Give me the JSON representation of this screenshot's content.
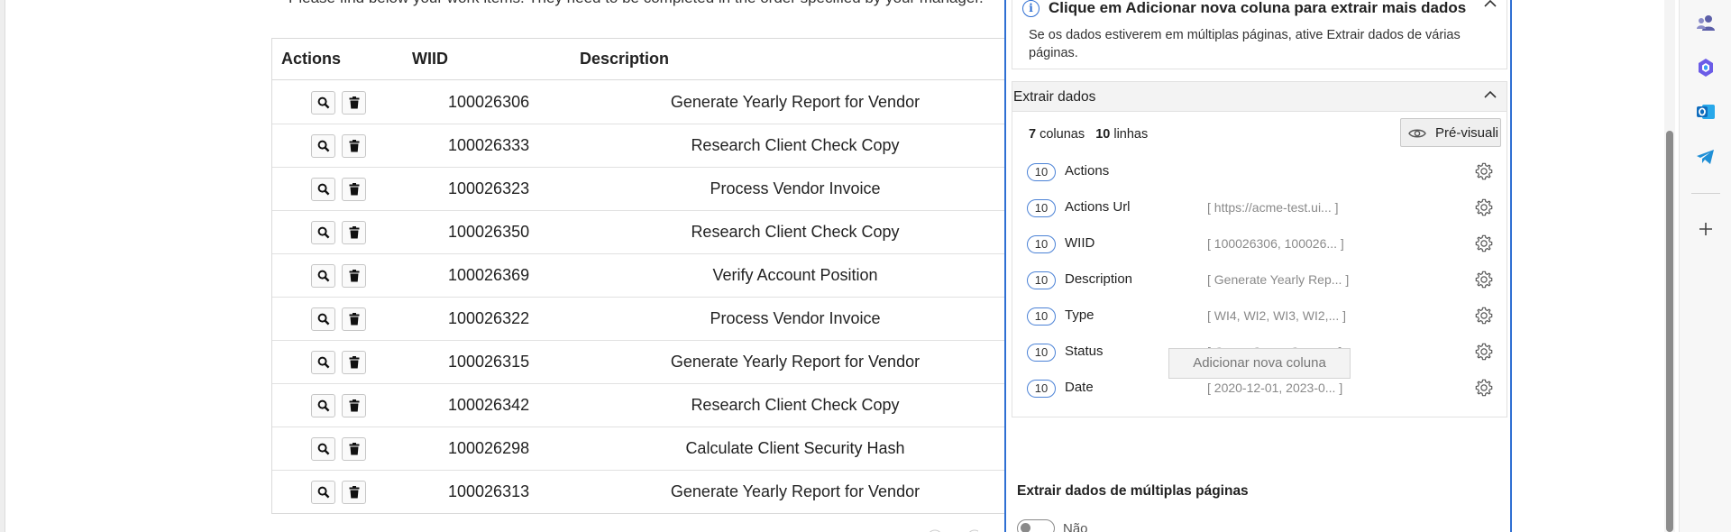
{
  "page": {
    "intro": "Please find below your work items. They need to be completed in the order specified by your manager."
  },
  "table": {
    "headers": {
      "actions": "Actions",
      "wiid": "WIID",
      "description": "Description"
    },
    "rows": [
      {
        "wiid": "100026306",
        "description": "Generate Yearly Report for Vendor"
      },
      {
        "wiid": "100026333",
        "description": "Research Client Check Copy"
      },
      {
        "wiid": "100026323",
        "description": "Process Vendor Invoice"
      },
      {
        "wiid": "100026350",
        "description": "Research Client Check Copy"
      },
      {
        "wiid": "100026369",
        "description": "Verify Account Position"
      },
      {
        "wiid": "100026322",
        "description": "Process Vendor Invoice"
      },
      {
        "wiid": "100026315",
        "description": "Generate Yearly Report for Vendor"
      },
      {
        "wiid": "100026342",
        "description": "Research Client Check Copy"
      },
      {
        "wiid": "100026298",
        "description": "Calculate Client Security Hash"
      },
      {
        "wiid": "100026313",
        "description": "Generate Yearly Report for Vendor"
      }
    ]
  },
  "panel": {
    "info": {
      "title": "Clique em Adicionar nova coluna para extrair mais dados",
      "text": "Se os dados estiverem em múltiplas páginas, ative Extrair dados de várias páginas."
    },
    "extract": {
      "title": "Extrair dados",
      "columns_count": "7",
      "columns_label": "colunas",
      "rows_count": "10",
      "rows_label": "linhas",
      "preview_label": "Pré-visuali",
      "fields": [
        {
          "count": "10",
          "name": "Actions",
          "preview": ""
        },
        {
          "count": "10",
          "name": "Actions Url",
          "preview": "[ https://acme-test.ui... ]"
        },
        {
          "count": "10",
          "name": "WIID",
          "preview": "[ 100026306, 100026... ]"
        },
        {
          "count": "10",
          "name": "Description",
          "preview": "[ Generate Yearly Rep... ]"
        },
        {
          "count": "10",
          "name": "Type",
          "preview": "[ WI4, WI2, WI3, WI2,... ]"
        },
        {
          "count": "10",
          "name": "Status",
          "preview": "[ Open, Open, Open,... ]"
        },
        {
          "count": "10",
          "name": "Date",
          "preview": "[ 2020-12-01, 2023-0... ]"
        }
      ],
      "add_column_label": "Adicionar nova coluna"
    },
    "multipage": {
      "title": "Extrair dados de múltiplas páginas",
      "toggle_label": "Não"
    }
  },
  "colors": {
    "accent": "#2f6fd3",
    "pill_border": "#4b82d6"
  },
  "icons": {
    "row_actions": [
      "search-icon",
      "trash-icon"
    ],
    "edge_sidebar": [
      "people-icon",
      "copilot-icon",
      "outlook-icon",
      "telegram-icon",
      "plus-icon"
    ]
  }
}
